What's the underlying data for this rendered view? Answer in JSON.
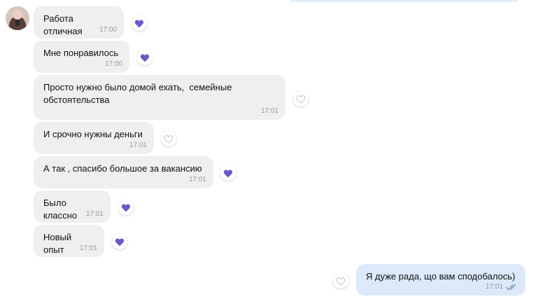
{
  "colors": {
    "liked_heart": "#6a58c8",
    "empty_heart_stroke": "#c4c4c4",
    "incoming_bubble": "#efefef",
    "outgoing_bubble": "#dbe9fa",
    "read_check": "#7f93b8"
  },
  "chat": {
    "messages": [
      {
        "text": "Работа отличная",
        "time": "17:00",
        "direction": "in",
        "liked": true
      },
      {
        "text": "Мне понравилось",
        "time": "17:00",
        "direction": "in",
        "liked": true
      },
      {
        "text": "Просто нужно было домой ехать,  семейные\nобстоятельства",
        "time": "17:01",
        "direction": "in",
        "liked": false
      },
      {
        "text": "И срочно нужны деньги",
        "time": "17:01",
        "direction": "in",
        "liked": false
      },
      {
        "text": "А так , спасибо большое за вакансию",
        "time": "17:01",
        "direction": "in",
        "liked": true
      },
      {
        "text": "Было классно",
        "time": "17:01",
        "direction": "in",
        "liked": true
      },
      {
        "text": "Новый опыт",
        "time": "17:01",
        "direction": "in",
        "liked": true
      },
      {
        "text": "Я дуже рада, що вам сподобалось)",
        "time": "17:01",
        "direction": "out",
        "liked": false,
        "status_icon": "double-check-icon"
      }
    ]
  }
}
